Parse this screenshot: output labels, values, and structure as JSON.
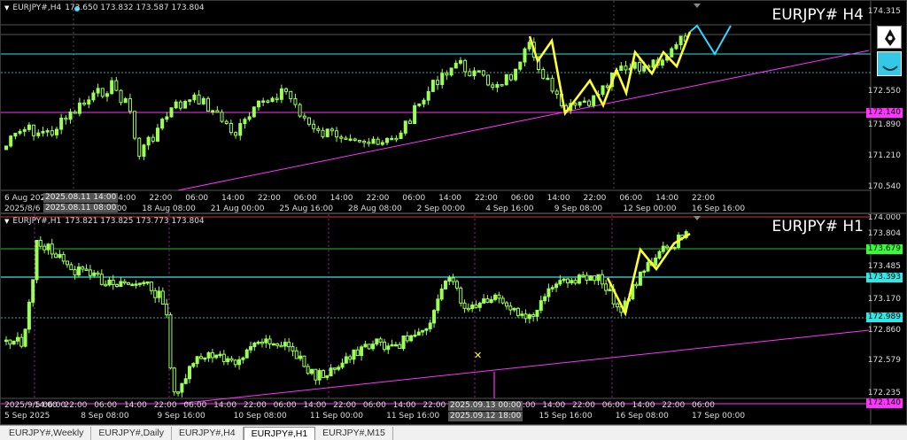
{
  "top_pane": {
    "symbol_info": "EURJPY#,H4",
    "ohlc": "173.650 173.832 173.587 173.804",
    "big_title": "EURJPY# H4",
    "price_labels": [
      {
        "text": "174.315",
        "type": "plain"
      },
      {
        "text": "172.550",
        "type": "plain"
      },
      {
        "text": "172.140",
        "type": "magenta"
      },
      {
        "text": "171.890",
        "type": "plain"
      },
      {
        "text": "171.210",
        "type": "plain"
      },
      {
        "text": "170.540",
        "type": "plain"
      }
    ],
    "time_labels": [
      "6 Aug 2025",
      "22:00",
      "06:00",
      "14:00",
      "22:00",
      "06:00",
      "14:00",
      "22:00",
      "06:00",
      "14:00",
      "22:00",
      "06:00",
      "14:00",
      "22:00",
      "06:00",
      "14:00",
      "22:00",
      "06:00",
      "14:00",
      "22:00"
    ],
    "time_labels_row2": [
      "2025/8/6 22:",
      "13 Aug 16:00",
      "18 Aug 08:00",
      "21 Aug 00:00",
      "25 Aug 16:00",
      "28 Aug 08:00",
      "2 Sep 00:00",
      "4 Sep 16:00",
      "9 Sep 08:00",
      "12 Sep 00:00",
      "16 Sep 16:00"
    ],
    "time_box_1": "2025.08.11 14:00",
    "time_box_2": "2025.08.11 08:00"
  },
  "bottom_pane": {
    "symbol_info": "EURJPY#,H1",
    "ohlc": "173.821 173.825 173.773 173.804",
    "big_title": "EURJPY# H1",
    "price_labels": [
      {
        "text": "174.000",
        "type": "plain"
      },
      {
        "text": "173.804",
        "type": "plain"
      },
      {
        "text": "173.679",
        "type": "green"
      },
      {
        "text": "173.485",
        "type": "plain"
      },
      {
        "text": "173.393",
        "type": "cyan"
      },
      {
        "text": "173.170",
        "type": "plain"
      },
      {
        "text": "172.989",
        "type": "cyan"
      },
      {
        "text": "172.860",
        "type": "plain"
      },
      {
        "text": "172.579",
        "type": "plain"
      },
      {
        "text": "172.235",
        "type": "plain"
      },
      {
        "text": "172.140",
        "type": "magenta"
      }
    ],
    "time_labels": [
      "2025/9/5 06:00",
      "14:00",
      "22:00",
      "06:00",
      "14:00",
      "22:00",
      "06:00",
      "14:00",
      "22:00",
      "06:00",
      "14:00",
      "22:00",
      "06:00",
      "14:00",
      "22:00",
      "14:",
      "22:00",
      "06:00",
      "14:00",
      "22:00",
      "06:00",
      "14:00",
      "22:00",
      "06:00"
    ],
    "time_labels_row2": [
      "5 Sep 2025",
      "8 Sep 08:00",
      "9 Sep 16:00",
      "10 Sep 08:00",
      "11 Sep 00:00",
      "11 Sep 16:00",
      "12",
      "15 Sep 16:00",
      "16 Sep 08:00",
      "17 Sep 00:00"
    ],
    "time_box_1": "2025.09.13 00:00",
    "time_box_2": "2025.09.12 18:00",
    "time_box_2_suffix": "Sep 00:00"
  },
  "tabs": [
    {
      "label": "EURJPY#,Weekly",
      "active": false
    },
    {
      "label": "EURJPY#,Daily",
      "active": false
    },
    {
      "label": "EURJPY#,H4",
      "active": false
    },
    {
      "label": "EURJPY#,H1",
      "active": true
    },
    {
      "label": "EURJPY#,M15",
      "active": false
    }
  ],
  "colors": {
    "candle": "#9cff57",
    "zigzag": "#ffff33",
    "projection": "#33d6ff",
    "trendline": "#ff33ff",
    "level_cyan": "#33e6e6",
    "label_magenta": "#ff33ff",
    "label_green": "#33ff33",
    "label_cyan": "#33e6e6"
  }
}
